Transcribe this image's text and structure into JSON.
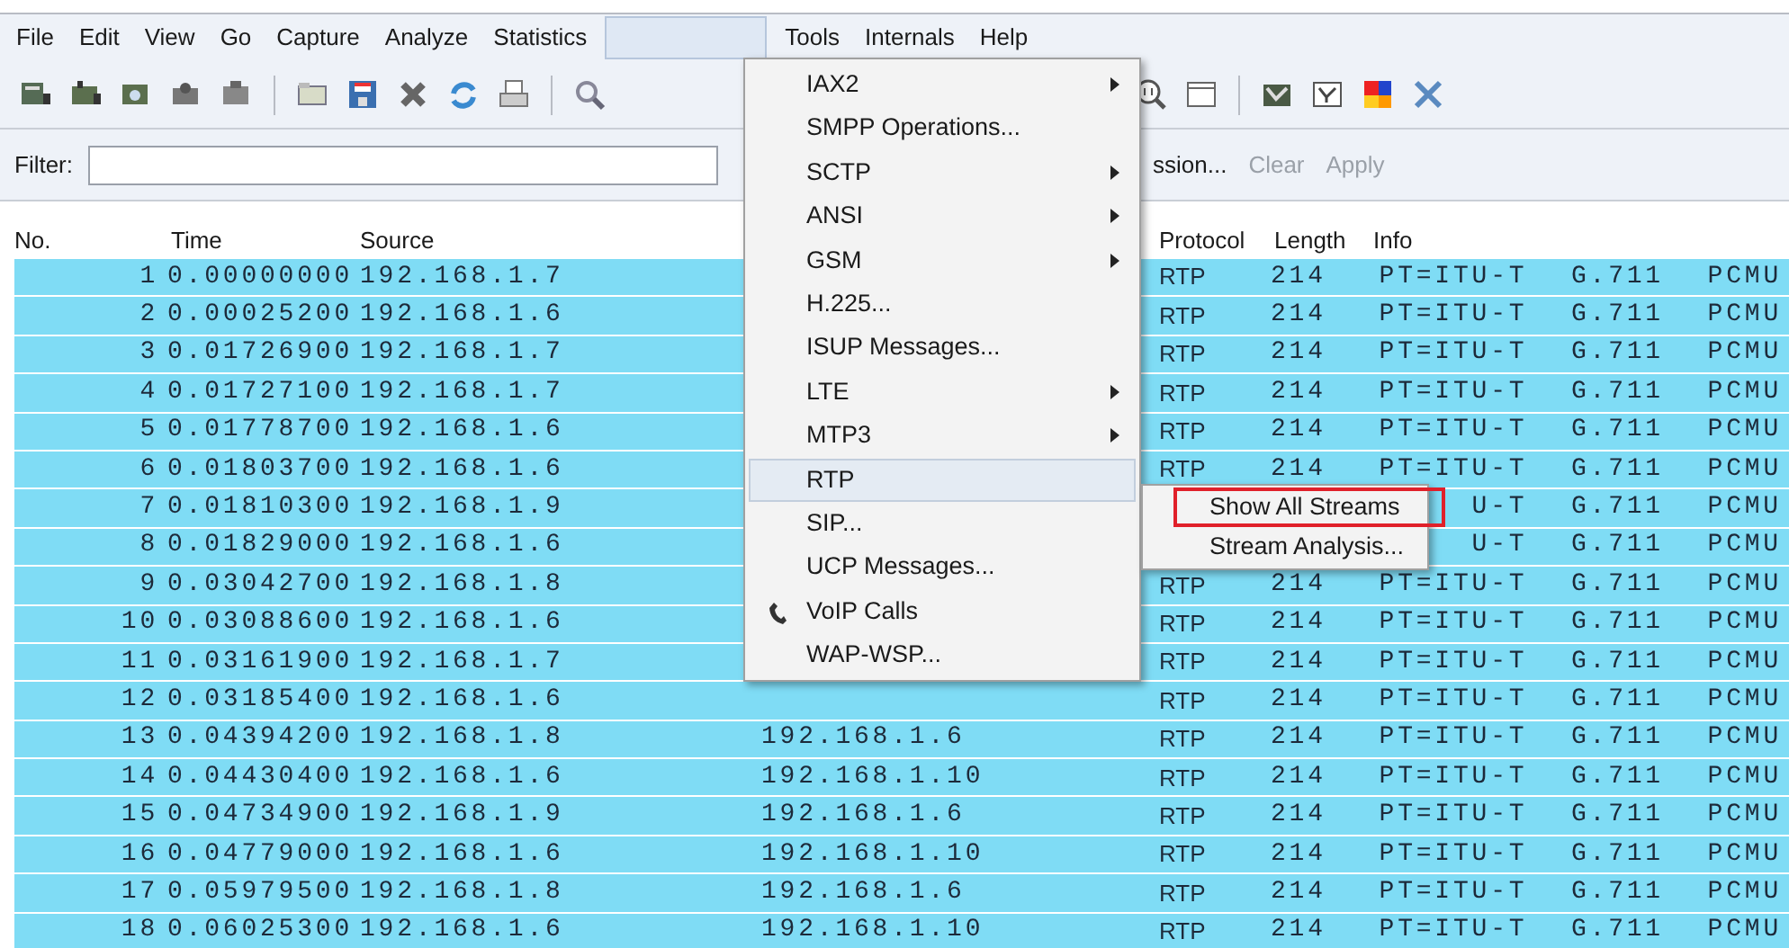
{
  "menu_bar": [
    {
      "label": "File"
    },
    {
      "label": "Edit"
    },
    {
      "label": "View"
    },
    {
      "label": "Go"
    },
    {
      "label": "Capture"
    },
    {
      "label": "Analyze"
    },
    {
      "label": "Statistics"
    },
    {
      "kind": "open"
    },
    {
      "label": "Tools"
    },
    {
      "label": "Internals"
    },
    {
      "label": "Help"
    }
  ],
  "filter_bar": {
    "label": "Filter:",
    "buttons": [
      {
        "label": "ssion...",
        "disabled": false
      },
      {
        "label": "Clear",
        "disabled": true
      },
      {
        "label": "Apply",
        "disabled": true
      }
    ]
  },
  "table": {
    "columns": [
      {
        "label": "No."
      },
      {
        "label": "Time"
      },
      {
        "label": "Source"
      },
      {
        "label": "Protocol"
      },
      {
        "label": "Length"
      },
      {
        "label": "Info"
      }
    ],
    "rows": [
      {
        "no": "1",
        "time": "0.00000000",
        "source": "192.168.1.7",
        "protocol": "RTP",
        "length": "214",
        "info": "PT=ITU-T G.711 PCMU"
      },
      {
        "no": "2",
        "time": "0.00025200",
        "source": "192.168.1.6",
        "protocol": "RTP",
        "length": "214",
        "info": "PT=ITU-T G.711 PCMU"
      },
      {
        "no": "3",
        "time": "0.01726900",
        "source": "192.168.1.7",
        "protocol": "RTP",
        "length": "214",
        "info": "PT=ITU-T G.711 PCMU"
      },
      {
        "no": "4",
        "time": "0.01727100",
        "source": "192.168.1.7",
        "protocol": "RTP",
        "length": "214",
        "info": "PT=ITU-T G.711 PCMU"
      },
      {
        "no": "5",
        "time": "0.01778700",
        "source": "192.168.1.6",
        "protocol": "RTP",
        "length": "214",
        "info": "PT=ITU-T G.711 PCMU"
      },
      {
        "no": "6",
        "time": "0.01803700",
        "source": "192.168.1.6",
        "protocol": "RTP",
        "length": "214",
        "info": "PT=ITU-T G.711 PCMU"
      },
      {
        "no": "7",
        "time": "0.01810300",
        "source": "192.168.1.9",
        "info": "U-T G.711 PCMU"
      },
      {
        "no": "8",
        "time": "0.01829000",
        "source": "192.168.1.6",
        "info": "U-T G.711 PCMU"
      },
      {
        "no": "9",
        "time": "0.03042700",
        "source": "192.168.1.8",
        "protocol": "RTP",
        "length": "214",
        "info": "PT=ITU-T G.711 PCMU"
      },
      {
        "no": "10",
        "time": "0.03088600",
        "source": "192.168.1.6",
        "protocol": "RTP",
        "length": "214",
        "info": "PT=ITU-T G.711 PCMU"
      },
      {
        "no": "11",
        "time": "0.03161900",
        "source": "192.168.1.7",
        "protocol": "RTP",
        "length": "214",
        "info": "PT=ITU-T G.711 PCMU"
      },
      {
        "no": "12",
        "time": "0.03185400",
        "source": "192.168.1.6",
        "protocol": "RTP",
        "length": "214",
        "info": "PT=ITU-T G.711 PCMU"
      },
      {
        "no": "13",
        "time": "0.04394200",
        "source": "192.168.1.8",
        "destination": "192.168.1.6",
        "protocol": "RTP",
        "length": "214",
        "info": "PT=ITU-T G.711 PCMU"
      },
      {
        "no": "14",
        "time": "0.04430400",
        "source": "192.168.1.6",
        "destination": "192.168.1.10",
        "protocol": "RTP",
        "length": "214",
        "info": "PT=ITU-T G.711 PCMU"
      },
      {
        "no": "15",
        "time": "0.04734900",
        "source": "192.168.1.9",
        "destination": "192.168.1.6",
        "protocol": "RTP",
        "length": "214",
        "info": "PT=ITU-T G.711 PCMU"
      },
      {
        "no": "16",
        "time": "0.04779000",
        "source": "192.168.1.6",
        "destination": "192.168.1.10",
        "protocol": "RTP",
        "length": "214",
        "info": "PT=ITU-T G.711 PCMU"
      },
      {
        "no": "17",
        "time": "0.05979500",
        "source": "192.168.1.8",
        "destination": "192.168.1.6",
        "protocol": "RTP",
        "length": "214",
        "info": "PT=ITU-T G.711 PCMU"
      },
      {
        "no": "18",
        "time": "0.06025300",
        "source": "192.168.1.6",
        "destination": "192.168.1.10",
        "protocol": "RTP",
        "length": "214",
        "info": "PT=ITU-T G.711 PCMU"
      }
    ]
  },
  "dropdown_menu": {
    "items": [
      {
        "label": "IAX2",
        "arrow": true,
        "has_icon": false,
        "selected": false
      },
      {
        "label": "SMPP Operations...",
        "arrow": false,
        "has_icon": false,
        "selected": false
      },
      {
        "label": "SCTP",
        "arrow": true,
        "has_icon": false,
        "selected": false
      },
      {
        "label": "ANSI",
        "arrow": true,
        "has_icon": false,
        "selected": false
      },
      {
        "label": "GSM",
        "arrow": true,
        "has_icon": false,
        "selected": false
      },
      {
        "label": "H.225...",
        "arrow": false,
        "has_icon": false,
        "selected": false
      },
      {
        "label": "ISUP Messages...",
        "arrow": false,
        "has_icon": false,
        "selected": false
      },
      {
        "label": "LTE",
        "arrow": true,
        "has_icon": false,
        "selected": false
      },
      {
        "label": "MTP3",
        "arrow": true,
        "has_icon": false,
        "selected": false
      },
      {
        "label": "RTP",
        "arrow": false,
        "has_icon": false,
        "selected": true
      },
      {
        "label": "SIP...",
        "arrow": false,
        "has_icon": false,
        "selected": false
      },
      {
        "label": "UCP Messages...",
        "arrow": false,
        "has_icon": false,
        "selected": false
      },
      {
        "label": "VoIP Calls",
        "arrow": false,
        "has_icon": true,
        "selected": false
      },
      {
        "label": "WAP-WSP...",
        "arrow": false,
        "has_icon": false,
        "selected": false
      }
    ]
  },
  "submenu": {
    "items": [
      {
        "label": "Show All Streams",
        "highlighted": true
      },
      {
        "label": "Stream Analysis...",
        "highlighted": false
      }
    ]
  }
}
